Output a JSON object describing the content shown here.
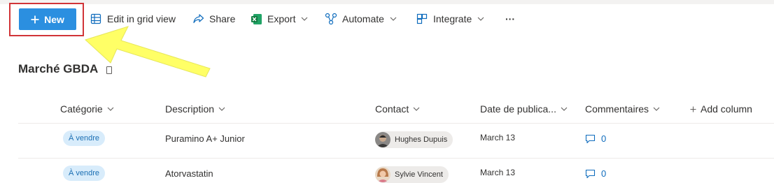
{
  "toolbar": {
    "new_label": "New",
    "edit_grid_label": "Edit in grid view",
    "share_label": "Share",
    "export_label": "Export",
    "automate_label": "Automate",
    "integrate_label": "Integrate",
    "more_label": "···"
  },
  "list": {
    "title": "Marché GBDA"
  },
  "columns": {
    "categorie": "Catégorie",
    "description": "Description",
    "contact": "Contact",
    "date": "Date de publica...",
    "commentaires": "Commentaires",
    "add_column": "Add column"
  },
  "rows": [
    {
      "categorie": "À vendre",
      "description": "Puramino A+ Junior",
      "contact": "Hughes Dupuis",
      "date": "March 13",
      "comments": "0"
    },
    {
      "categorie": "À vendre",
      "description": "Atorvastatin",
      "contact": "Sylvie Vincent",
      "date": "March 13",
      "comments": "0"
    }
  ],
  "colors": {
    "accent": "#2b8fe0",
    "highlight_border": "#d13438",
    "annotation_arrow": "#ffff66",
    "pill_bg": "#d8ecfb"
  },
  "icons": [
    "plus-icon",
    "grid-icon",
    "share-icon",
    "excel-icon",
    "automate-icon",
    "integrate-icon",
    "more-icon",
    "chevron-down-icon",
    "comment-icon"
  ]
}
